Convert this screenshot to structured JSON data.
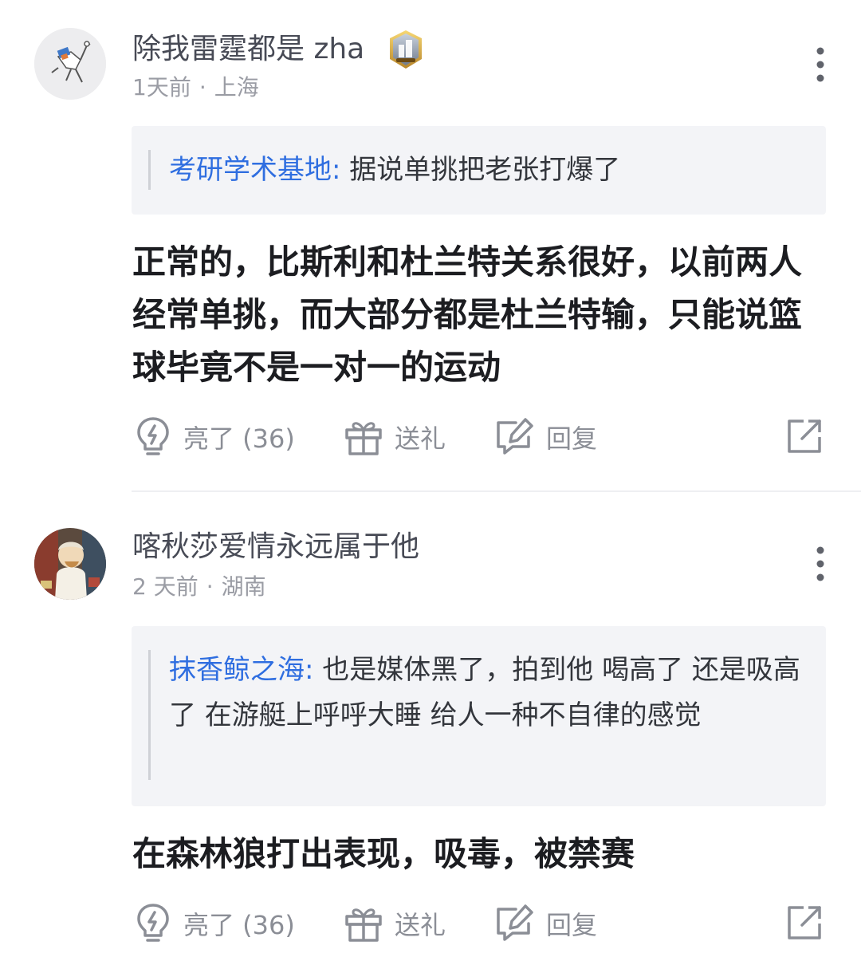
{
  "comments": [
    {
      "username": "除我雷霆都是 zha",
      "badge_icon": "rank-badge-icon",
      "time": "1天前",
      "location": "上海",
      "quote": {
        "author": "考研学术基地:",
        "text": "据说单挑把老张打爆了"
      },
      "body": "正常的，比斯利和杜兰特关系很好，以前两人经常单挑，而大部分都是杜兰特输，只能说篮球毕竟不是一对一的运动",
      "actions": {
        "like_label": "亮了 (36)",
        "gift_label": "送礼",
        "reply_label": "回复"
      }
    },
    {
      "username": "喀秋莎爱情永远属于他",
      "time": "2 天前",
      "location": "湖南",
      "quote": {
        "author": "抹香鲸之海:",
        "text": "也是媒体黑了，拍到他 喝高了 还是吸高了 在游艇上呼呼大睡 给人一种不自律的感觉"
      },
      "body": "在森林狼打出表现，吸毒，被禁赛",
      "actions": {
        "like_label": "亮了 (36)",
        "gift_label": "送礼",
        "reply_label": "回复"
      }
    }
  ],
  "separator": "·",
  "icons": {
    "like": "lightbulb-icon",
    "gift": "gift-icon",
    "reply": "reply-edit-icon",
    "share": "share-icon",
    "more": "more-vertical-icon"
  },
  "colors": {
    "link": "#2f6ee0",
    "muted": "#9a9ca4",
    "quote_bg": "#f3f4f7",
    "text": "#1c1d21"
  }
}
